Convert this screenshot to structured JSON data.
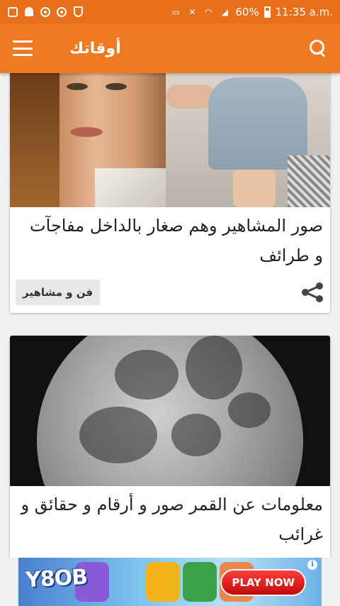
{
  "status_bar": {
    "battery": "60%",
    "time": "11:35 a.m.",
    "left_icons": [
      "app-icon",
      "notification-bell-icon",
      "location-icon",
      "location-icon",
      "shield-icon"
    ],
    "right_icons": [
      "cast-icon",
      "mute-icon",
      "wifi-icon",
      "signal-icon",
      "battery-icon"
    ]
  },
  "app_bar": {
    "title": "أوقاتك",
    "menu_icon": "hamburger-menu-icon",
    "search_icon": "search-icon",
    "background": "#f07a22"
  },
  "feed": {
    "articles": [
      {
        "title": "صور المشاهير وهم صغار بالداخل مفاجآت و طرائف",
        "category": "فن و مشاهير",
        "image": "celebrity-childhood-photo",
        "share_icon": "share-icon"
      },
      {
        "title": "معلومات عن القمر صور و أرقام و حقائق و غرائب",
        "image": "moon-photo"
      }
    ]
  },
  "ad": {
    "brand": "Y8OB",
    "cta": "PLAY NOW",
    "info_label": "i"
  }
}
